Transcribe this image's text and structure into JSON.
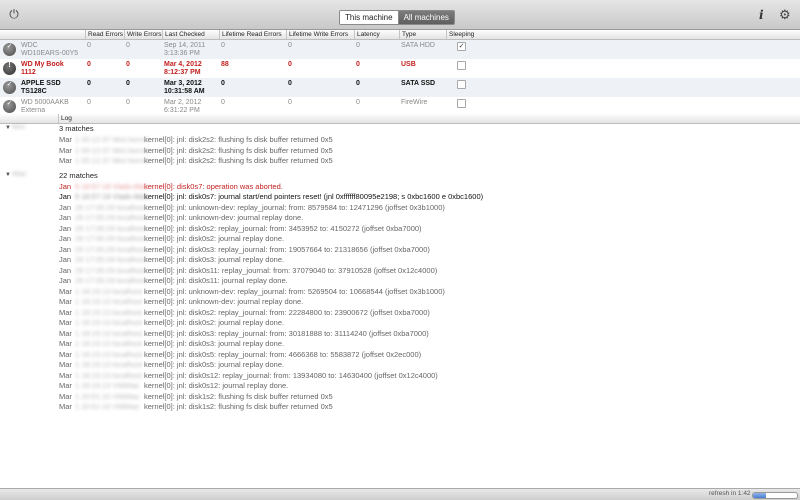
{
  "toolbar": {
    "power_icon": "power-icon",
    "tabs": [
      "This machine",
      "All machines"
    ],
    "selected_tab": "All machines",
    "info_label": "i",
    "gear_icon": "gear-icon"
  },
  "disk_table": {
    "columns": [
      "Read Errors",
      "Write Errors",
      "Last Checked",
      "Lifetime Read Errors",
      "Lifetime Write Errors",
      "Latency",
      "Type",
      "Sleeping"
    ],
    "rows": [
      {
        "name_line1": "WDC",
        "name_line2": "WD10EARS-00Y5",
        "status": "ok",
        "read_errors": "0",
        "write_errors": "0",
        "last_checked_date": "Sep 14, 2011",
        "last_checked_time": "3:13:36 PM",
        "lifetime_read": "0",
        "lifetime_write": "0",
        "latency": "0",
        "type": "SATA HDD",
        "sleeping": true,
        "style": "gray"
      },
      {
        "name_line1": "WD My Book",
        "name_line2": "1112",
        "status": "error",
        "read_errors": "0",
        "write_errors": "0",
        "last_checked_date": "Mar 4, 2012",
        "last_checked_time": "8:12:37 PM",
        "lifetime_read": "88",
        "lifetime_write": "0",
        "latency": "0",
        "type": "USB",
        "sleeping": false,
        "style": "red"
      },
      {
        "name_line1": "APPLE SSD",
        "name_line2": "TS128C",
        "status": "ok",
        "read_errors": "0",
        "write_errors": "0",
        "last_checked_date": "Mar 3, 2012",
        "last_checked_time": "10:31:58 AM",
        "lifetime_read": "0",
        "lifetime_write": "0",
        "latency": "0",
        "type": "SATA SSD",
        "sleeping": false,
        "style": "black"
      },
      {
        "name_line1": "WD 5000AAKB",
        "name_line2": "Externa",
        "status": "ok",
        "read_errors": "0",
        "write_errors": "0",
        "last_checked_date": "Mar 2, 2012",
        "last_checked_time": "6:31:22 PM",
        "lifetime_read": "0",
        "lifetime_write": "0",
        "latency": "0",
        "type": "FireWire",
        "sleeping": false,
        "style": "gray"
      }
    ]
  },
  "log": {
    "header": "Log",
    "groups": [
      {
        "machine": "Mini",
        "matches": "3 matches",
        "lines": [
          {
            "month": "Mar",
            "meta": "1 00:12:37 Mini kernel",
            "text": "kernel[0]: jnl: disk2s2: flushing fs disk buffer returned 0x5",
            "style": "normal"
          },
          {
            "month": "Mar",
            "meta": "1 00:12:37 Mini kernel",
            "text": "kernel[0]: jnl: disk2s2: flushing fs disk buffer returned 0x5",
            "style": "normal"
          },
          {
            "month": "Mar",
            "meta": "1 00:12:37 Mini kernel",
            "text": "kernel[0]: jnl: disk2s2: flushing fs disk buffer returned 0x5",
            "style": "normal"
          }
        ]
      },
      {
        "machine": "iMac",
        "matches": "22 matches",
        "lines": [
          {
            "month": "Jan",
            "meta": "5 16:57:19 Vlads-iMac",
            "text": "kernel[0]: disk0s7: operation was aborted.",
            "style": "red"
          },
          {
            "month": "Jan",
            "meta": "5 16:57:19 Vlads-iMac",
            "text": "kernel[0]: jnl: disk0s7: journal start/end pointers reset! (jnl 0xffffff80095e2198; s 0xbc1600 e 0xbc1600)",
            "style": "bold"
          },
          {
            "month": "Jan",
            "meta": "29 17:05:29 localhost",
            "text": "kernel[0]: jnl: unknown-dev: replay_journal: from: 8579584 to: 12471296 (joffset 0x3b1000)",
            "style": "normal"
          },
          {
            "month": "Jan",
            "meta": "29 17:05:29 localhost",
            "text": "kernel[0]: jnl: unknown-dev: journal replay done.",
            "style": "normal"
          },
          {
            "month": "Jan",
            "meta": "29 17:05:29 localhost",
            "text": "kernel[0]: jnl: disk0s2: replay_journal: from: 3453952 to: 4150272 (joffset 0xba7000)",
            "style": "normal"
          },
          {
            "month": "Jan",
            "meta": "29 17:05:29 localhost",
            "text": "kernel[0]: jnl: disk0s2: journal replay done.",
            "style": "normal"
          },
          {
            "month": "Jan",
            "meta": "29 17:05:29 localhost",
            "text": "kernel[0]: jnl: disk0s3: replay_journal: from: 19057664 to: 21318656 (joffset 0xba7000)",
            "style": "normal"
          },
          {
            "month": "Jan",
            "meta": "29 17:05:29 localhost",
            "text": "kernel[0]: jnl: disk0s3: journal replay done.",
            "style": "normal"
          },
          {
            "month": "Jan",
            "meta": "29 17:05:29 localhost",
            "text": "kernel[0]: jnl: disk0s11: replay_journal: from: 37079040 to: 37910528 (joffset 0x12c4000)",
            "style": "normal"
          },
          {
            "month": "Jan",
            "meta": "29 17:05:29 localhost",
            "text": "kernel[0]: jnl: disk0s11: journal replay done.",
            "style": "normal"
          },
          {
            "month": "Mar",
            "meta": "1 18:15:13 localhost",
            "text": "kernel[0]: jnl: unknown-dev: replay_journal: from: 5269504 to: 10668544 (joffset 0x3b1000)",
            "style": "normal"
          },
          {
            "month": "Mar",
            "meta": "1 18:15:13 localhost",
            "text": "kernel[0]: jnl: unknown-dev: journal replay done.",
            "style": "normal"
          },
          {
            "month": "Mar",
            "meta": "1 18:15:13 localhost",
            "text": "kernel[0]: jnl: disk0s2: replay_journal: from: 22284800 to: 23900672 (joffset 0xba7000)",
            "style": "normal"
          },
          {
            "month": "Mar",
            "meta": "1 18:15:13 localhost",
            "text": "kernel[0]: jnl: disk0s2: journal replay done.",
            "style": "normal"
          },
          {
            "month": "Mar",
            "meta": "1 18:15:13 localhost",
            "text": "kernel[0]: jnl: disk0s3: replay_journal: from: 30181888 to: 31114240 (joffset 0xba7000)",
            "style": "normal"
          },
          {
            "month": "Mar",
            "meta": "1 18:15:13 localhost",
            "text": "kernel[0]: jnl: disk0s3: journal replay done.",
            "style": "normal"
          },
          {
            "month": "Mar",
            "meta": "1 18:15:13 localhost",
            "text": "kernel[0]: jnl: disk0s5: replay_journal: from: 4666368 to: 5583872 (joffset 0x2ec000)",
            "style": "normal"
          },
          {
            "month": "Mar",
            "meta": "1 18:15:13 localhost",
            "text": "kernel[0]: jnl: disk0s5: journal replay done.",
            "style": "normal"
          },
          {
            "month": "Mar",
            "meta": "1 18:15:13 localhost",
            "text": "kernel[0]: jnl: disk0s12: replay_journal: from: 13934080 to: 14630400 (joffset 0x12c4000)",
            "style": "normal"
          },
          {
            "month": "Mar",
            "meta": "1 18:15:13 VMiMac",
            "text": "kernel[0]: jnl: disk0s12: journal replay done.",
            "style": "normal"
          },
          {
            "month": "Mar",
            "meta": "1 20:51:10 VMiMac",
            "text": "kernel[0]: jnl: disk1s2: flushing fs disk buffer returned 0x5",
            "style": "normal"
          },
          {
            "month": "Mar",
            "meta": "1 20:51:10 VMiMac",
            "text": "kernel[0]: jnl: disk1s2: flushing fs disk buffer returned 0x5",
            "style": "normal"
          }
        ]
      }
    ]
  },
  "status_bar": {
    "refresh_text": "refresh in 1:42",
    "refresh_progress": 0.3
  }
}
